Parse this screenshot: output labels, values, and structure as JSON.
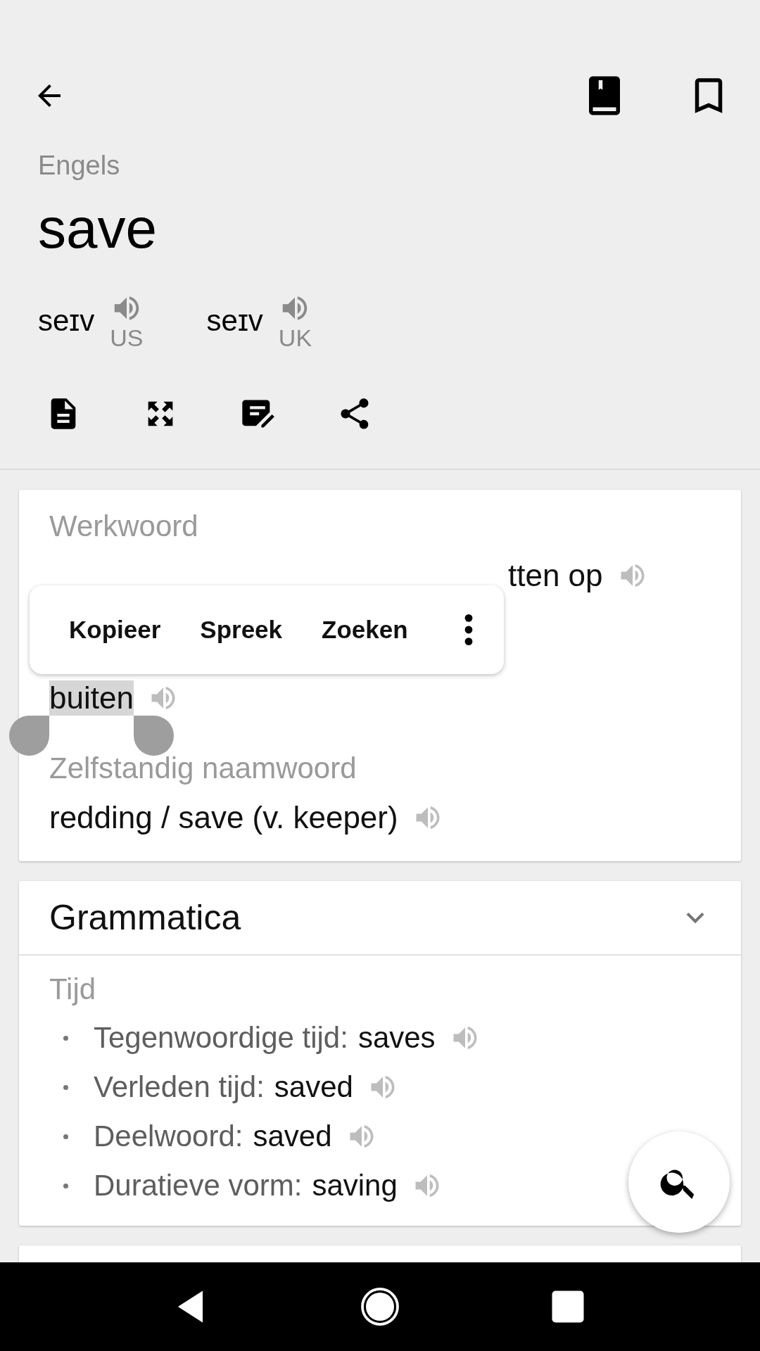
{
  "header": {
    "language": "Engels",
    "word": "save",
    "pronunciations": [
      {
        "ipa": "seɪv",
        "region": "US"
      },
      {
        "ipa": "seɪv",
        "region": "UK"
      }
    ]
  },
  "meanings": {
    "sections": [
      {
        "part_of_speech": "Werkwoord",
        "lines": [
          {
            "text": "tten op",
            "selected": false
          },
          {
            "text": "buiten",
            "selected": true
          }
        ]
      },
      {
        "part_of_speech": "Zelfstandig naamwoord",
        "lines": [
          {
            "text": "redding / save (v. keeper)",
            "selected": false
          }
        ]
      }
    ]
  },
  "text_menu": {
    "items": [
      "Kopieer",
      "Spreek",
      "Zoeken"
    ]
  },
  "grammar": {
    "title": "Grammatica",
    "expanded": true,
    "group": "Tijd",
    "forms": [
      {
        "label": "Tegenwoordige tijd:",
        "value": "saves"
      },
      {
        "label": "Verleden tijd:",
        "value": "saved"
      },
      {
        "label": "Deelwoord:",
        "value": "saved"
      },
      {
        "label": "Duratieve vorm:",
        "value": "saving"
      }
    ]
  }
}
